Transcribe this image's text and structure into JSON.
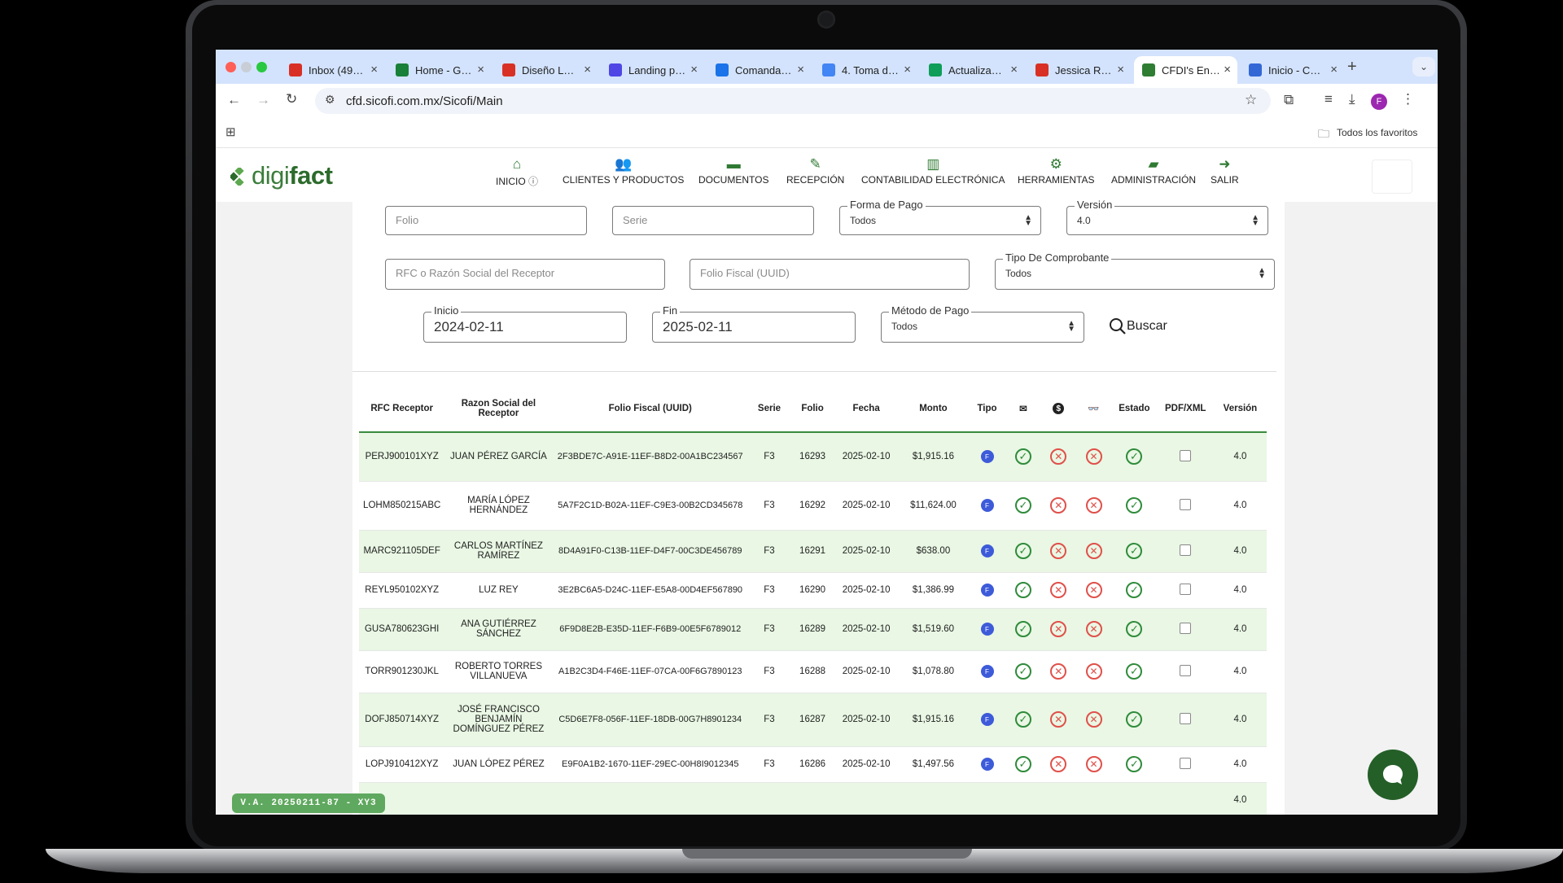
{
  "browser": {
    "tabs": [
      {
        "label": "Inbox (49…",
        "color": "#d93025"
      },
      {
        "label": "Home - G…",
        "color": "#188038"
      },
      {
        "label": "Diseño L…",
        "color": "#d93025"
      },
      {
        "label": "Landing p…",
        "color": "#4f46e5"
      },
      {
        "label": "Comanda…",
        "color": "#1a73e8"
      },
      {
        "label": "4. Toma d…",
        "color": "#4285f4"
      },
      {
        "label": "Actualiza…",
        "color": "#0f9d58"
      },
      {
        "label": "Jessica R…",
        "color": "#d93025"
      },
      {
        "label": "CFDI's En…",
        "color": "#2e7d32"
      },
      {
        "label": "Inicio - C…",
        "color": "#3367d6"
      }
    ],
    "url": "cfd.sicofi.com.mx/Sicofi/Main",
    "bookmarks_label": "Todos los favoritos",
    "profile_initial": "F"
  },
  "app": {
    "logo_prefix": "digi",
    "logo_suffix": "fact",
    "nav": [
      {
        "label": "INICIO",
        "icon": "home-icon"
      },
      {
        "label": "CLIENTES Y PRODUCTOS",
        "icon": "users-icon"
      },
      {
        "label": "DOCUMENTOS",
        "icon": "folder-icon"
      },
      {
        "label": "RECEPCIÓN",
        "icon": "edit-icon"
      },
      {
        "label": "CONTABILIDAD ELECTRÓNICA",
        "icon": "chart-icon"
      },
      {
        "label": "HERRAMIENTAS",
        "icon": "gears-icon"
      },
      {
        "label": "ADMINISTRACIÓN",
        "icon": "folder-open-icon"
      },
      {
        "label": "SALIR",
        "icon": "sign-out-icon"
      }
    ]
  },
  "filters": {
    "folio_placeholder": "Folio",
    "serie_placeholder": "Serie",
    "forma_pago_label": "Forma de Pago",
    "forma_pago_value": "Todos",
    "version_label": "Versión",
    "version_value": "4.0",
    "rfc_placeholder": "RFC o Razón Social del Receptor",
    "uuid_placeholder": "Folio Fiscal (UUID)",
    "tipo_label": "Tipo De Comprobante",
    "tipo_value": "Todos",
    "inicio_label": "Inicio",
    "inicio_value": "2024-02-11",
    "fin_label": "Fin",
    "fin_value": "2025-02-11",
    "metodo_label": "Método de Pago",
    "metodo_value": "Todos",
    "search_label": "Buscar"
  },
  "table": {
    "headers": [
      "RFC Receptor",
      "Razon Social del Receptor",
      "Folio Fiscal (UUID)",
      "Serie",
      "Folio",
      "Fecha",
      "Monto",
      "Tipo",
      "",
      "",
      "",
      "Estado",
      "PDF/XML",
      "Versión"
    ],
    "rows": [
      {
        "rfc": "PERJ900101XYZ",
        "razon": "JUAN PÉREZ GARCÍA",
        "uuid": "2F3BDE7C-A91E-11EF-B8D2-00A1BC234567",
        "serie": "F3",
        "folio": "16293",
        "fecha": "2025-02-10",
        "monto": "$1,915.16",
        "version": "4.0"
      },
      {
        "rfc": "LOHM850215ABC",
        "razon": "MARÍA LÓPEZ HERNÁNDEZ",
        "uuid": "5A7F2C1D-B02A-11EF-C9E3-00B2CD345678",
        "serie": "F3",
        "folio": "16292",
        "fecha": "2025-02-10",
        "monto": "$11,624.00",
        "version": "4.0"
      },
      {
        "rfc": "MARC921105DEF",
        "razon": "CARLOS MARTÍNEZ RAMÍREZ",
        "uuid": "8D4A91F0-C13B-11EF-D4F7-00C3DE456789",
        "serie": "F3",
        "folio": "16291",
        "fecha": "2025-02-10",
        "monto": "$638.00",
        "version": "4.0"
      },
      {
        "rfc": "REYL950102XYZ",
        "razon": "LUZ REY",
        "uuid": "3E2BC6A5-D24C-11EF-E5A8-00D4EF567890",
        "serie": "F3",
        "folio": "16290",
        "fecha": "2025-02-10",
        "monto": "$1,386.99",
        "version": "4.0"
      },
      {
        "rfc": "GUSA780623GHI",
        "razon": "ANA GUTIÉRREZ SÁNCHEZ",
        "uuid": "6F9D8E2B-E35D-11EF-F6B9-00E5F6789012",
        "serie": "F3",
        "folio": "16289",
        "fecha": "2025-02-10",
        "monto": "$1,519.60",
        "version": "4.0"
      },
      {
        "rfc": "TORR901230JKL",
        "razon": "ROBERTO TORRES VILLANUEVA",
        "uuid": "A1B2C3D4-F46E-11EF-07CA-00F6G7890123",
        "serie": "F3",
        "folio": "16288",
        "fecha": "2025-02-10",
        "monto": "$1,078.80",
        "version": "4.0"
      },
      {
        "rfc": "DOFJ850714XYZ",
        "razon": "JOSÉ FRANCISCO BENJAMÍN DOMÍNGUEZ PÉREZ",
        "uuid": "C5D6E7F8-056F-11EF-18DB-00G7H8901234",
        "serie": "F3",
        "folio": "16287",
        "fecha": "2025-02-10",
        "monto": "$1,915.16",
        "version": "4.0"
      },
      {
        "rfc": "LOPJ910412XYZ",
        "razon": "JUAN LÓPEZ PÉREZ",
        "uuid": "E9F0A1B2-1670-11EF-29EC-00H8I9012345",
        "serie": "F3",
        "folio": "16286",
        "fecha": "2025-02-10",
        "monto": "$1,497.56",
        "version": "4.0"
      },
      {
        "rfc": "",
        "razon": "",
        "uuid": "",
        "serie": "",
        "folio": "",
        "fecha": "",
        "monto": "",
        "version": "4.0"
      }
    ],
    "tipo_badge": "F"
  },
  "footer": {
    "version_badge": "V.A. 20250211-87 - XY3"
  },
  "colors": {
    "accent": "#2e7d32",
    "row_highlight": "#e9f7e4",
    "check": "#2e8b3a",
    "cross": "#e0504a"
  }
}
